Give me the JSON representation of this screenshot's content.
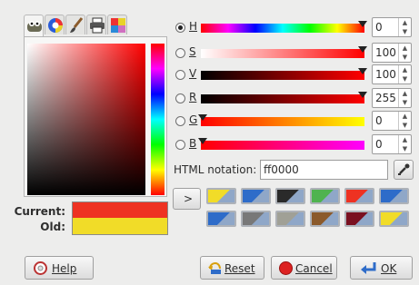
{
  "tabs": [
    {
      "icon": "gimp-wilber-icon"
    },
    {
      "icon": "color-wheel-icon"
    },
    {
      "icon": "paintbrush-icon"
    },
    {
      "icon": "printer-cmyk-icon"
    },
    {
      "icon": "palette-swatches-icon"
    }
  ],
  "swatches": {
    "current_label": "Current:",
    "old_label": "Old:",
    "current_color": "#ee3222",
    "old_color": "#f1dc28"
  },
  "channels": [
    {
      "label": "H",
      "value": "0",
      "selected": true
    },
    {
      "label": "S",
      "value": "100",
      "selected": false
    },
    {
      "label": "V",
      "value": "100",
      "selected": false
    },
    {
      "label": "R",
      "value": "255",
      "selected": false
    },
    {
      "label": "G",
      "value": "0",
      "selected": false
    },
    {
      "label": "B",
      "value": "0",
      "selected": false
    }
  ],
  "html_notation": {
    "label": "HTML notation:",
    "value": "ff0000"
  },
  "history_toggle": ">",
  "history": [
    "#f1dc28",
    "#2e6cc9",
    "#2a2a2a",
    "#4fb34f",
    "#ee3222",
    "#2e6cc9",
    "#2e6cc9",
    "#787878",
    "#a0a096",
    "#8b5a2b",
    "#7a1020",
    "#f1dc28"
  ],
  "buttons": {
    "help": "Help",
    "reset": "Reset",
    "cancel": "Cancel",
    "ok": "OK"
  },
  "colors": {
    "accent": "#ff0000"
  }
}
